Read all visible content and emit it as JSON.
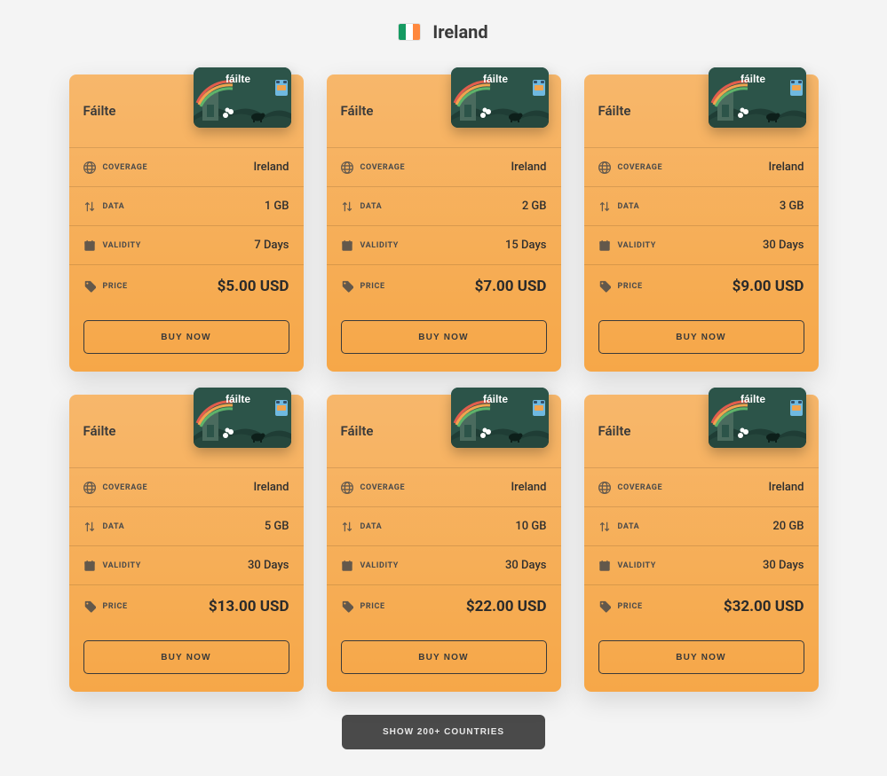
{
  "header": {
    "country": "Ireland",
    "flag_colors": {
      "left": "#169b62",
      "mid": "#ffffff",
      "right": "#ff883e"
    }
  },
  "labels": {
    "coverage": "COVERAGE",
    "data": "DATA",
    "validity": "VALIDITY",
    "price": "PRICE",
    "buy": "BUY NOW",
    "show_more": "SHOW 200+ COUNTRIES"
  },
  "card_brand": "fáilte",
  "plans": [
    {
      "title": "Fáilte",
      "coverage": "Ireland",
      "data": "1 GB",
      "validity": "7 Days",
      "price": "$5.00 USD"
    },
    {
      "title": "Fáilte",
      "coverage": "Ireland",
      "data": "2 GB",
      "validity": "15 Days",
      "price": "$7.00 USD"
    },
    {
      "title": "Fáilte",
      "coverage": "Ireland",
      "data": "3 GB",
      "validity": "30 Days",
      "price": "$9.00 USD"
    },
    {
      "title": "Fáilte",
      "coverage": "Ireland",
      "data": "5 GB",
      "validity": "30 Days",
      "price": "$13.00 USD"
    },
    {
      "title": "Fáilte",
      "coverage": "Ireland",
      "data": "10 GB",
      "validity": "30 Days",
      "price": "$22.00 USD"
    },
    {
      "title": "Fáilte",
      "coverage": "Ireland",
      "data": "20 GB",
      "validity": "30 Days",
      "price": "$32.00 USD"
    }
  ]
}
